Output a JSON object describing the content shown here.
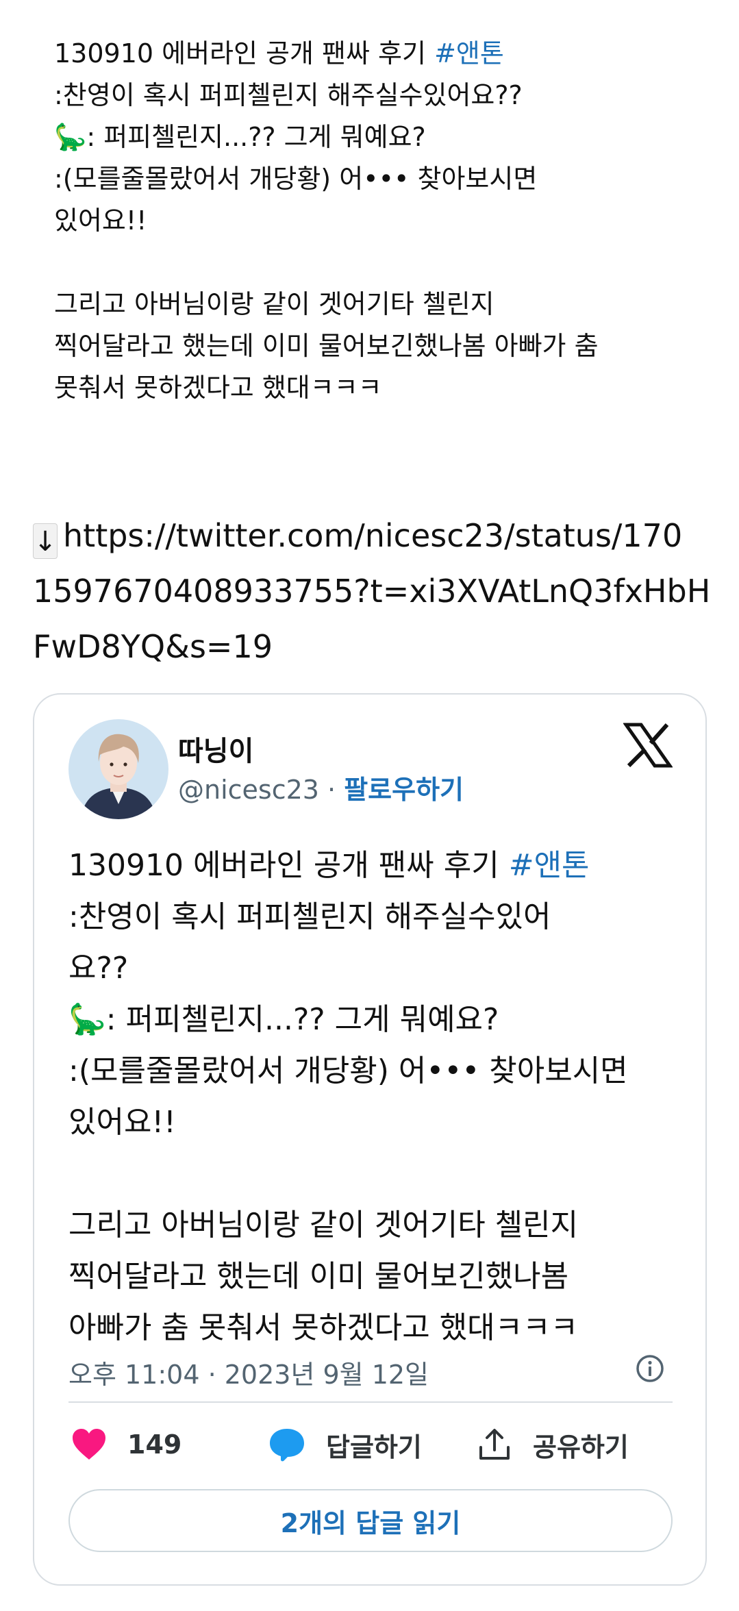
{
  "top_text": {
    "lines": [
      {
        "text": "130910 에버라인 공개 팬싸 후기 ",
        "hashtag": "#앤톤"
      },
      {
        "text": ":찬영이 혹시 퍼피첼린지 해주실수있어요??"
      },
      {
        "text": "🦕: 퍼피첼린지...?? 그게 뭐예요?"
      },
      {
        "text": ":(모를줄몰랐어서 개당황) 어••• 찾아보시면"
      },
      {
        "text": "있어요!!"
      },
      {
        "text": ""
      },
      {
        "text": "그리고 아버님이랑 같이 겟어기타 첼린지"
      },
      {
        "text": "찍어달라고 했는데 이미 물어보긴했나봄 아빠가 춤"
      },
      {
        "text": "못춰서 못하겠다고 했대ㅋㅋㅋ"
      }
    ]
  },
  "link": {
    "arrow": "↓",
    "url_lines": [
      "https://twitter.com/nicesc23/status/170",
      "1597670408933755?t=xi3XVAtLnQ3fxHbH",
      "FwD8YQ&s=19"
    ]
  },
  "embed": {
    "author_name": "따닝이",
    "handle": "@nicesc23",
    "separator": " · ",
    "follow_label": "팔로우하기",
    "logo_icon": "x-logo-icon",
    "text_lines": [
      {
        "text": "130910 에버라인 공개 팬싸 후기 ",
        "hashtag": "#앤톤"
      },
      {
        "text": ":찬영이 혹시 퍼피첼린지 해주실수있어"
      },
      {
        "text": "요??"
      },
      {
        "text": "🦕: 퍼피첼린지...?? 그게 뭐예요?"
      },
      {
        "text": ":(모를줄몰랐어서 개당황) 어••• 찾아보시면"
      },
      {
        "text": "있어요!!"
      },
      {
        "text": ""
      },
      {
        "text": "그리고 아버님이랑 같이 겟어기타 첼린지"
      },
      {
        "text": "찍어달라고 했는데 이미 물어보긴했나봄"
      },
      {
        "text": "아빠가 춤 못춰서 못하겠다고 했대ㅋㅋㅋ"
      }
    ],
    "timestamp": "오후 11:04 · 2023년 9월 12일",
    "like_count": "149",
    "reply_label": "답글하기",
    "share_label": "공유하기",
    "read_replies_label": "2개의 답글 읽기",
    "colors": {
      "link": "#1d70b8",
      "like": "#f91880",
      "reply": "#1d9bf0",
      "muted": "#536471"
    }
  }
}
